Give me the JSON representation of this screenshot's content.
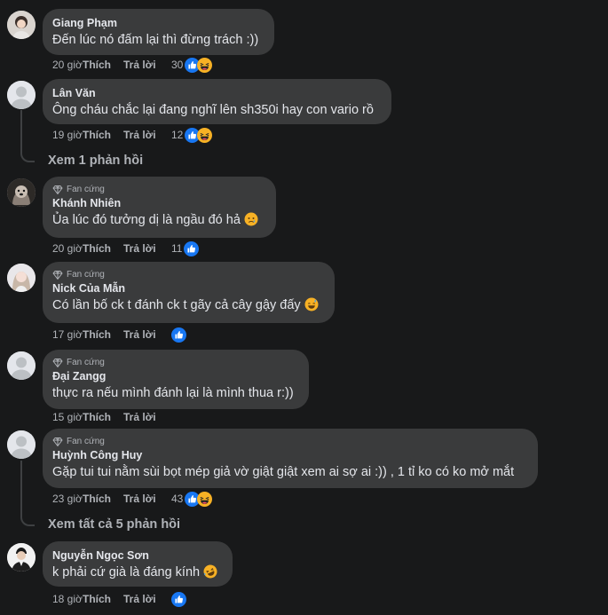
{
  "actions": {
    "like": "Thích",
    "reply": "Trả lời"
  },
  "comments": [
    {
      "author": "Giang Phạm",
      "badge": "",
      "text": "Đến lúc nó đấm lại thì đừng trách :))",
      "time": "20 giờ",
      "reaction_count": "30",
      "reactions": [
        "like-reaction-icon",
        "haha-reaction-icon"
      ],
      "avatar": "avatar-photo-girl"
    },
    {
      "author": "Lân Văn",
      "badge": "",
      "text": "Ông cháu chắc lại đang nghĩ lên sh350i hay con vario rồ",
      "time": "19 giờ",
      "reaction_count": "12",
      "reactions": [
        "like-reaction-icon",
        "haha-reaction-icon"
      ],
      "avatar": "default-avatar"
    },
    {
      "author": "Khánh Nhiên",
      "badge": "Fan cứng",
      "text": "Ủa lúc đó tưởng dị là ngầu đó hả",
      "text_emoji": "sad-face-emoji",
      "time": "20 giờ",
      "reaction_count": "11",
      "reactions": [
        "like-reaction-icon"
      ],
      "avatar": "avatar-photo-dog"
    },
    {
      "author": "Nick Của Mẫn",
      "badge": "Fan cứng",
      "text": "Có lần bố ck t đánh ck t gãy cả cây gậy đấy",
      "text_emoji": "sweat-smile-emoji",
      "time": "17 giờ",
      "reaction_count": "",
      "reactions": [
        "like-reaction-icon"
      ],
      "avatar": "avatar-photo-girl-2"
    },
    {
      "author": "Đại Zangg",
      "badge": "Fan cứng",
      "text": "thực ra nếu mình đánh lại là mình thua r:))",
      "time": "15 giờ",
      "reaction_count": "",
      "reactions": [],
      "avatar": "default-avatar"
    },
    {
      "author": "Huỳnh Công Huy",
      "badge": "Fan cứng",
      "text": "Gặp tui tui nằm sùi bọt mép giả vờ giật giật xem ai sợ ai :)) , 1 tỉ ko có ko mở mắt",
      "time": "23 giờ",
      "reaction_count": "43",
      "reactions": [
        "like-reaction-icon",
        "haha-reaction-icon"
      ],
      "avatar": "default-avatar"
    },
    {
      "author": "Nguyễn Ngọc Sơn",
      "badge": "",
      "text": "k phải cứ già là đáng kính",
      "text_emoji": "rofl-emoji",
      "time": "18 giờ",
      "reaction_count": "",
      "reactions": [
        "like-reaction-icon"
      ],
      "avatar": "avatar-photo-man"
    }
  ],
  "view_replies": {
    "reply_1": "Xem 1 phản hồi",
    "reply_5": "Xem tất cả 5 phản hồi"
  },
  "colors": {
    "background": "#18191a",
    "bubble": "#3a3b3c",
    "text": "#e4e6eb",
    "secondary_text": "#b0b3b8",
    "like_blue": "#1877f2",
    "haha_yellow": "#f7b125"
  }
}
